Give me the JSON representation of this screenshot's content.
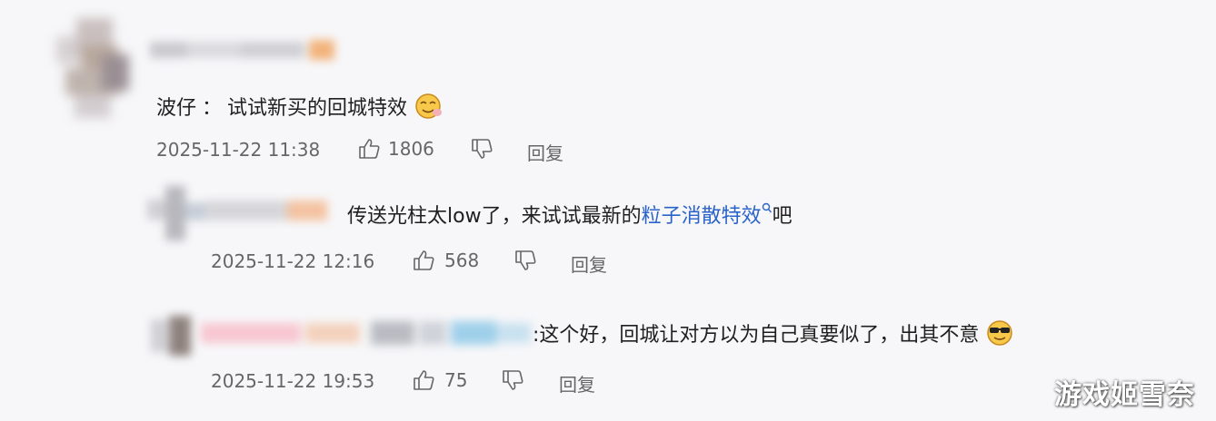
{
  "comments": [
    {
      "author": "波仔",
      "separator": "：",
      "text": "试试新买的回城特效",
      "emoji": "drooling-face-emoji",
      "time": "2025-11-22 11:38",
      "likes": "1806",
      "reply_label": "回复"
    },
    {
      "text_before": "传送光柱太low了，来试试最新的",
      "link_text": "粒子消散特效",
      "text_after": "吧",
      "time": "2025-11-22 12:16",
      "likes": "568",
      "reply_label": "回复"
    },
    {
      "text": ":这个好，回城让对方以为自己真要似了，出其不意",
      "emoji": "cool-sunglasses-emoji",
      "time": "2025-11-22 19:53",
      "likes": "75",
      "reply_label": "回复"
    }
  ],
  "watermark": "游戏姬雪奈",
  "colors": {
    "link": "#2a63c9",
    "meta": "#666666",
    "text": "#1f1f1f"
  }
}
